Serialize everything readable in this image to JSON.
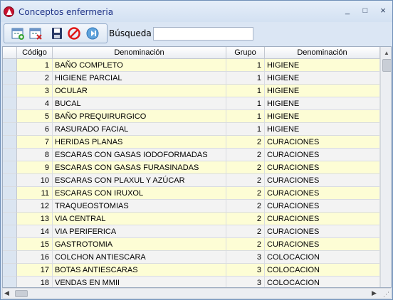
{
  "window": {
    "title": "Conceptos enfermeria",
    "controls": {
      "minimize": "_",
      "maximize": "□",
      "close": "×"
    }
  },
  "toolbar": {
    "buttons": [
      {
        "name": "new-record-icon"
      },
      {
        "name": "delete-record-icon"
      },
      {
        "name": "save-icon"
      },
      {
        "name": "cancel-icon"
      },
      {
        "name": "next-icon"
      }
    ],
    "search_label": "Búsqueda",
    "search_value": ""
  },
  "grid": {
    "columns": [
      "Código",
      "Denominación",
      "Grupo",
      "Denominación"
    ],
    "rows": [
      {
        "codigo": "1",
        "denominacion": "BAÑO COMPLETO",
        "grupo": "1",
        "grupo_denominacion": "HIGIENE"
      },
      {
        "codigo": "2",
        "denominacion": "HIGIENE PARCIAL",
        "grupo": "1",
        "grupo_denominacion": "HIGIENE"
      },
      {
        "codigo": "3",
        "denominacion": "OCULAR",
        "grupo": "1",
        "grupo_denominacion": "HIGIENE"
      },
      {
        "codigo": "4",
        "denominacion": "BUCAL",
        "grupo": "1",
        "grupo_denominacion": "HIGIENE"
      },
      {
        "codigo": "5",
        "denominacion": "BAÑO PREQUIRURGICO",
        "grupo": "1",
        "grupo_denominacion": "HIGIENE"
      },
      {
        "codigo": "6",
        "denominacion": "RASURADO FACIAL",
        "grupo": "1",
        "grupo_denominacion": "HIGIENE"
      },
      {
        "codigo": "7",
        "denominacion": "HERIDAS PLANAS",
        "grupo": "2",
        "grupo_denominacion": "CURACIONES"
      },
      {
        "codigo": "8",
        "denominacion": "ESCARAS CON GASAS IODOFORMADAS",
        "grupo": "2",
        "grupo_denominacion": "CURACIONES"
      },
      {
        "codigo": "9",
        "denominacion": "ESCARAS CON GASAS FURASINADAS",
        "grupo": "2",
        "grupo_denominacion": "CURACIONES"
      },
      {
        "codigo": "10",
        "denominacion": "ESCARAS CON PLAXUL Y AZÚCAR",
        "grupo": "2",
        "grupo_denominacion": "CURACIONES"
      },
      {
        "codigo": "11",
        "denominacion": "ESCARAS CON IRUXOL",
        "grupo": "2",
        "grupo_denominacion": "CURACIONES"
      },
      {
        "codigo": "12",
        "denominacion": "TRAQUEOSTOMIAS",
        "grupo": "2",
        "grupo_denominacion": "CURACIONES"
      },
      {
        "codigo": "13",
        "denominacion": "VIA CENTRAL",
        "grupo": "2",
        "grupo_denominacion": "CURACIONES"
      },
      {
        "codigo": "14",
        "denominacion": "VIA PERIFERICA",
        "grupo": "2",
        "grupo_denominacion": "CURACIONES"
      },
      {
        "codigo": "15",
        "denominacion": "GASTROTOMIA",
        "grupo": "2",
        "grupo_denominacion": "CURACIONES"
      },
      {
        "codigo": "16",
        "denominacion": "COLCHON ANTIESCARA",
        "grupo": "3",
        "grupo_denominacion": "COLOCACION"
      },
      {
        "codigo": "17",
        "denominacion": "BOTAS ANTIESCARAS",
        "grupo": "3",
        "grupo_denominacion": "COLOCACION"
      },
      {
        "codigo": "18",
        "denominacion": "VENDAS EN MMII",
        "grupo": "3",
        "grupo_denominacion": "COLOCACION"
      }
    ]
  },
  "colors": {
    "title_text": "#1e3287",
    "row_odd": "#fdfdd5",
    "row_even": "#f3f3f3",
    "window_bg": "#dbe6f4"
  }
}
